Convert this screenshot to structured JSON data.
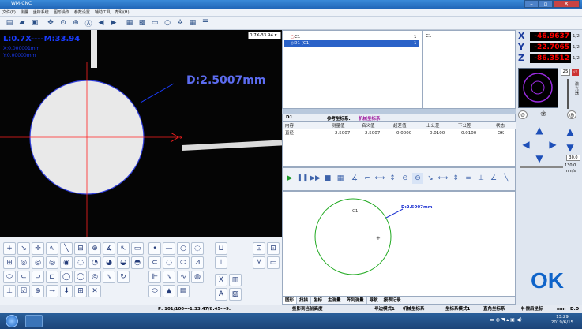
{
  "window": {
    "title": "WM-CNC",
    "min": "–",
    "max": "▫",
    "close": "✕"
  },
  "menu": [
    "文件(F)",
    "测量",
    "坐标系统",
    "图形操作",
    "参数设置",
    "辅助工具",
    "帮助(H)"
  ],
  "video": {
    "overlay_top": "L:0.7X----M:33.94",
    "overlay_x": "X:0.000001mm",
    "overlay_y": "Y:0.00000mm",
    "measure_label": "D:2.5007mm",
    "cross_marker": "x",
    "zoom": "0.7X-33.94"
  },
  "element_list": {
    "rows": [
      {
        "label": "C1",
        "num": "1"
      },
      {
        "label": "D1 (C1)",
        "num": "1"
      }
    ],
    "detail": "C1"
  },
  "table": {
    "element": "D1",
    "ref_label": "参考坐标系:",
    "ref_value": "机械坐标系",
    "headers": [
      "内容",
      "测量值",
      "名义值",
      "超差值",
      "上公差",
      "下公差",
      "状态"
    ],
    "row": [
      "直径",
      "2.5007",
      "2.5007",
      "0.0000",
      "0.0100",
      "-0.0100",
      "OK"
    ]
  },
  "graph": {
    "circle_label": "C1",
    "dim_label": "D:2.5007mm",
    "center_mark": "+"
  },
  "tabs": [
    "图形",
    "扫描",
    "坐标",
    "主测量",
    "阵列测量",
    "导航",
    "报表记录"
  ],
  "status": {
    "progress": "P: 101/100---1:33:47/8:45---9:",
    "item2": "投影到当前高度",
    "item3": "寻边模式1",
    "item4": "机械坐标系",
    "item5": "坐标系模式1",
    "item6": "直角坐标系",
    "item7": "补偿后坐标",
    "item8": "mm",
    "item9": "D.D"
  },
  "dro": {
    "x_label": "X",
    "x_value": "-46.9637",
    "y_label": "Y",
    "y_value": "-22.7065",
    "z_label": "Z",
    "z_value": "-86.3512",
    "x_half": "1/2",
    "y_half": "1/2",
    "z_half": "1/2"
  },
  "light": {
    "value": "25",
    "side_text1": "激",
    "side_text2": "光",
    "side_text3": "器"
  },
  "jog": {
    "speed_value": "30.0",
    "speed2": "130.0",
    "unit": "mm/s"
  },
  "ok_text": "OK",
  "clock": {
    "time": "13:29",
    "date": "2019/6/15"
  },
  "colors": {
    "video_bg": "#050505",
    "crosshair": "#ff2020",
    "measure": "#1a3cff",
    "dro_value": "#ff0000",
    "ok": "#0e63c9",
    "graph_circle": "#22aa22"
  }
}
